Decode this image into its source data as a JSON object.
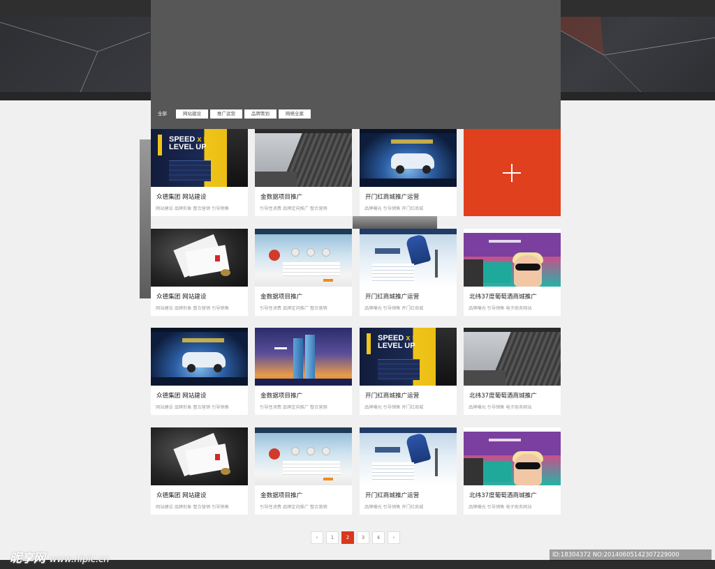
{
  "filters": [
    "全部",
    "网站建设",
    "推广运营",
    "品牌策划",
    "网络全案"
  ],
  "cards": [
    {
      "title": "众德集团  网站建设",
      "tags": "网站建设  品牌形象  整合营销  引导销售",
      "thumb": "speed"
    },
    {
      "title": "金数据项目推广",
      "tags": "引导性消费  品牌定向推广  整合营销",
      "thumb": "build"
    },
    {
      "title": "开门红商城推广运营",
      "tags": "品牌曝光  引导销售  开门红商城",
      "thumb": "car"
    },
    {
      "title": "众德集团  网站建设",
      "tags": "网站建设  品牌形象  整合营销  引导销售",
      "thumb": "env"
    },
    {
      "title": "金数据项目推广",
      "tags": "引导性消费  品牌定向推广  整合营销",
      "thumb": "web"
    },
    {
      "title": "开门红商城推广运营",
      "tags": "品牌曝光  引导销售  开门红商城",
      "thumb": "ski"
    },
    {
      "title": "北纬37度葡萄酒商城推广",
      "tags": "品牌曝光  引导销售  电子商务网站",
      "thumb": "purple"
    },
    {
      "title": "众德集团  网站建设",
      "tags": "网站建设  品牌形象  整合营销  引导销售",
      "thumb": "car"
    },
    {
      "title": "金数据项目推广",
      "tags": "引导性消费  品牌定向推广  整合营销",
      "thumb": "city"
    },
    {
      "title": "开门红商城推广运营",
      "tags": "品牌曝光  引导销售  开门红商城",
      "thumb": "speed"
    },
    {
      "title": "北纬37度葡萄酒商城推广",
      "tags": "品牌曝光  引导销售  电子商务网站",
      "thumb": "build"
    },
    {
      "title": "众德集团  网站建设",
      "tags": "网站建设  品牌形象  整合营销  引导销售",
      "thumb": "env"
    },
    {
      "title": "金数据项目推广",
      "tags": "引导性消费  品牌定向推广  整合营销",
      "thumb": "web"
    },
    {
      "title": "开门红商城推广运营",
      "tags": "品牌曝光  引导销售  开门红商城",
      "thumb": "ski"
    },
    {
      "title": "北纬37度葡萄酒商城推广",
      "tags": "品牌曝光  引导销售  电子商务网站",
      "thumb": "purple"
    }
  ],
  "pagination": {
    "prev": "‹",
    "pages": [
      "1",
      "2",
      "3",
      "4"
    ],
    "current": "2",
    "next": "›"
  },
  "watermark": {
    "left_brand": "昵享网",
    "left_url": "www.nipic.cn",
    "right_id": "ID:18304372 NO:20140605142307229000"
  },
  "colors": {
    "accent": "#e0401e",
    "panel": "#575757"
  }
}
